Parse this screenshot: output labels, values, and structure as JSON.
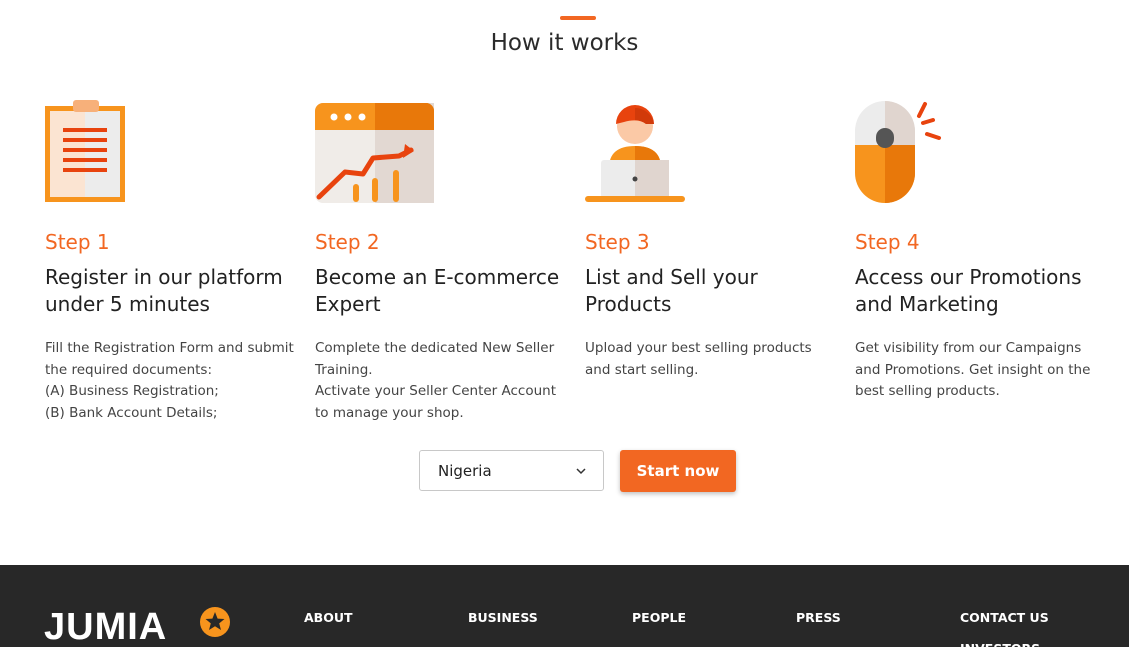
{
  "section": {
    "title": "How it works"
  },
  "steps": [
    {
      "label": "Step 1",
      "heading": "Register in our platform under 5 minutes",
      "description": [
        "Fill the Registration Form and submit the required documents:",
        "(A) Business Registration;",
        "(B) Bank Account Details;"
      ],
      "icon": "clipboard-icon"
    },
    {
      "label": "Step 2",
      "heading": "Become an E-commerce Expert",
      "description": [
        "Complete the dedicated New Seller Training.",
        "Activate your Seller Center Account to manage your shop."
      ],
      "icon": "growth-chart-icon"
    },
    {
      "label": "Step 3",
      "heading": "List and Sell your Products",
      "description": [
        "Upload your best selling products and start selling."
      ],
      "icon": "seller-laptop-icon"
    },
    {
      "label": "Step 4",
      "heading": "Access our Promotions and Marketing",
      "description": [
        "Get visibility from our Campaigns and Promotions. Get insight on the best selling products."
      ],
      "icon": "mouse-click-icon"
    }
  ],
  "country_select": {
    "value": "Nigeria"
  },
  "start_button": {
    "label": "Start now"
  },
  "footer": {
    "logo": "JUMIA",
    "links": [
      "ABOUT",
      "BUSINESS",
      "PEOPLE",
      "PRESS",
      "CONTACT US"
    ],
    "partial_link": "INVESTORS"
  },
  "colors": {
    "accent": "#f26722",
    "footer_bg": "#282828"
  }
}
